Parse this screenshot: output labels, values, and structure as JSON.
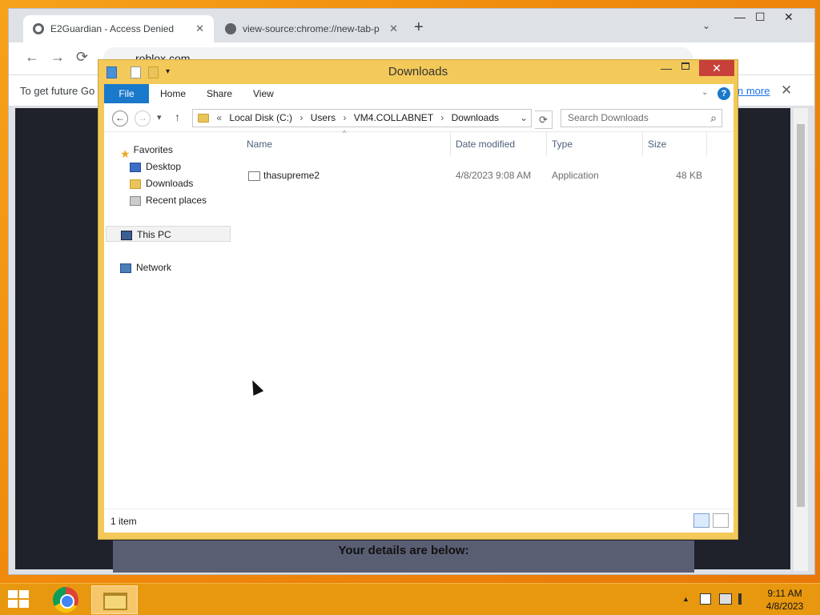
{
  "chrome": {
    "tabs": [
      {
        "title": "E2Guardian - Access Denied",
        "close": "✕"
      },
      {
        "title": "view-source:chrome://new-tab-p",
        "close": "✕"
      }
    ],
    "new_tab": "+",
    "tab_search": "⌄",
    "minimize": "—",
    "maximize": "☐",
    "close": "✕",
    "back": "←",
    "forward": "→",
    "reload": "⟳",
    "url": "roblox.com",
    "infobar_text": "To get future Go",
    "infobar_link": "n more",
    "infobar_close": "✕",
    "page_heading": "Your details are below:"
  },
  "explorer": {
    "title": "Downloads",
    "minimize": "—",
    "close": "✕",
    "ribbon_tabs": {
      "file": "File",
      "home": "Home",
      "share": "Share",
      "view": "View"
    },
    "help": "?",
    "ribbon_chevron": "⌄",
    "back": "←",
    "forward": "→",
    "recent": "▾",
    "up": "↑",
    "breadcrumb": {
      "prefix": "«",
      "items": [
        "Local Disk (C:)",
        "Users",
        "VM4.COLLABNET",
        "Downloads"
      ],
      "sep": "›"
    },
    "addr_dropdown": "⌄",
    "refresh": "⟳",
    "search_placeholder": "Search Downloads",
    "search_icon": "⌕",
    "nav": {
      "favorites": "Favorites",
      "desktop": "Desktop",
      "downloads": "Downloads",
      "recent_places": "Recent places",
      "this_pc": "This PC",
      "network": "Network"
    },
    "columns": {
      "name": "Name",
      "date": "Date modified",
      "type": "Type",
      "size": "Size"
    },
    "sort_arrow": "^",
    "files": [
      {
        "name": "thasupreme2",
        "date": "4/8/2023 9:08 AM",
        "type": "Application",
        "size": "48 KB"
      }
    ],
    "status": "1 item"
  },
  "taskbar": {
    "clock_time": "9:11 AM",
    "clock_date": "4/8/2023",
    "tray_up": "▲"
  },
  "colors": {
    "explorer_frame": "#f3c95a",
    "ribbon_blue": "#1979ca",
    "taskbar": "#e8980f",
    "close_red": "#c7403a"
  }
}
